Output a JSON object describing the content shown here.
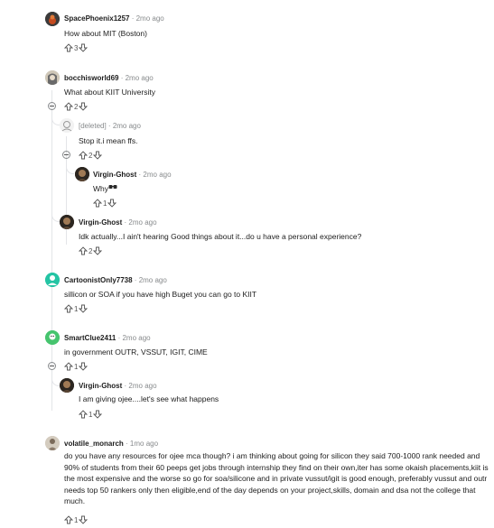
{
  "vote_icons": {
    "up": "arrow-up-icon",
    "down": "arrow-down-icon"
  },
  "comments": [
    {
      "user": "SpacePhoenix1257",
      "time": "2mo ago",
      "body": "How about MIT (Boston)",
      "votes": "3"
    },
    {
      "user": "bocchisworld69",
      "time": "2mo ago",
      "body": "What about KIIT University",
      "votes": "2"
    },
    {
      "user": "[deleted]",
      "time": "2mo ago",
      "body": "Stop it.i mean ffs.",
      "votes": "2"
    },
    {
      "user": "Virgin-Ghost",
      "time": "2mo ago",
      "body": "Why",
      "votes": "1"
    },
    {
      "user": "Virgin-Ghost",
      "time": "2mo ago",
      "body": "Idk actually...I ain't hearing Good things about it...do u have a personal experience?",
      "votes": "2"
    },
    {
      "user": "CartoonistOnly7738",
      "time": "2mo ago",
      "body": "sillicon or SOA if you have high Buget you can go to KIIT",
      "votes": "1"
    },
    {
      "user": "SmartClue2411",
      "time": "2mo ago",
      "body": "in government OUTR, VSSUT, IGIT, CIME",
      "votes": "1"
    },
    {
      "user": "Virgin-Ghost",
      "time": "2mo ago",
      "body": "I am giving ojee....let's see what happens",
      "votes": "1"
    },
    {
      "user": "volatile_monarch",
      "time": "1mo ago",
      "body": "do you have any resources for ojee mca though? i am thinking about going for silicon they said 700-1000 rank needed and 90% of students from their 60 peeps get jobs through internship they find on their own,iter has some okaish placements,kiit is the most expensive and the worse so go for soa/silicone and in private vussut/igit is good enough, preferably vussut and outr needs top 50 rankers only then eligible,end of the day depends on your project,skills, domain and dsa not the college that much.",
      "votes": "1"
    }
  ],
  "colors": {
    "time": "#878a8c",
    "thread_line": "#e3e5e8",
    "cartoonist_avatar": "#24c4a4",
    "smartclue_avatar": "#46c46e"
  }
}
